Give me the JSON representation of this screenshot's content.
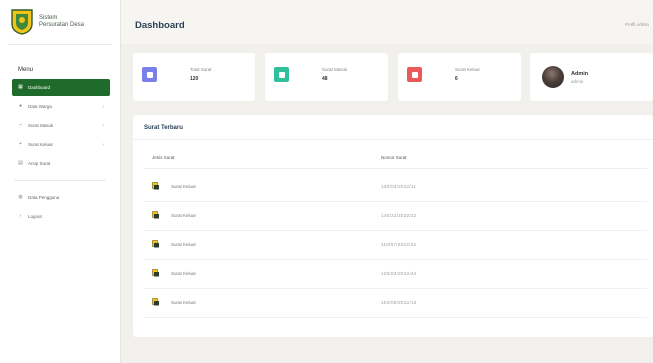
{
  "brand": {
    "line1": "Sistem",
    "line2": "Persuratan Desa"
  },
  "sidebar": {
    "menu_title": "Menu",
    "items": [
      {
        "label": "Dashboard",
        "icon": "grid-icon",
        "has_chevron": false,
        "active": true
      },
      {
        "label": "Data Warga",
        "icon": "users-icon",
        "has_chevron": true,
        "active": false
      },
      {
        "label": "Surat Masuk",
        "icon": "inbox-icon",
        "has_chevron": true,
        "active": false
      },
      {
        "label": "Surat Keluar",
        "icon": "send-icon",
        "has_chevron": true,
        "active": false
      },
      {
        "label": "Arsip Surat",
        "icon": "archive-icon",
        "has_chevron": false,
        "active": false
      }
    ],
    "bottom_items": [
      {
        "label": "Data Pengguna",
        "icon": "user-icon"
      },
      {
        "label": "Logout",
        "icon": "logout-icon"
      }
    ]
  },
  "header": {
    "title": "Dashboard",
    "user_link": "Profil Admin"
  },
  "stats": [
    {
      "label": "Total Surat",
      "value": "120",
      "color": "#7b7fe8"
    },
    {
      "label": "Surat Masuk",
      "value": "48",
      "color": "#2fbf9a"
    },
    {
      "label": "Surat Keluar",
      "value": "6",
      "color": "#ea5a5a"
    }
  ],
  "profile": {
    "name": "Admin",
    "role": "admin"
  },
  "table": {
    "title": "Surat Terbaru",
    "columns": [
      "Jenis Surat",
      "Nomor Surat"
    ],
    "rows": [
      {
        "jenis": "Surat Keluar",
        "nomor": "130/03/2022/11"
      },
      {
        "jenis": "Surat Keluar",
        "nomor": "140/23/2022/22"
      },
      {
        "jenis": "Surat Keluar",
        "nomor": "110/07/2022/33"
      },
      {
        "jenis": "Surat Keluar",
        "nomor": "120/03/2022/44"
      },
      {
        "jenis": "Surat Keluar",
        "nomor": "100/09/2022/13"
      }
    ]
  },
  "colors": {
    "accent": "#1f6b2c",
    "title": "#2a3f55",
    "background": "#f1f0ec"
  }
}
